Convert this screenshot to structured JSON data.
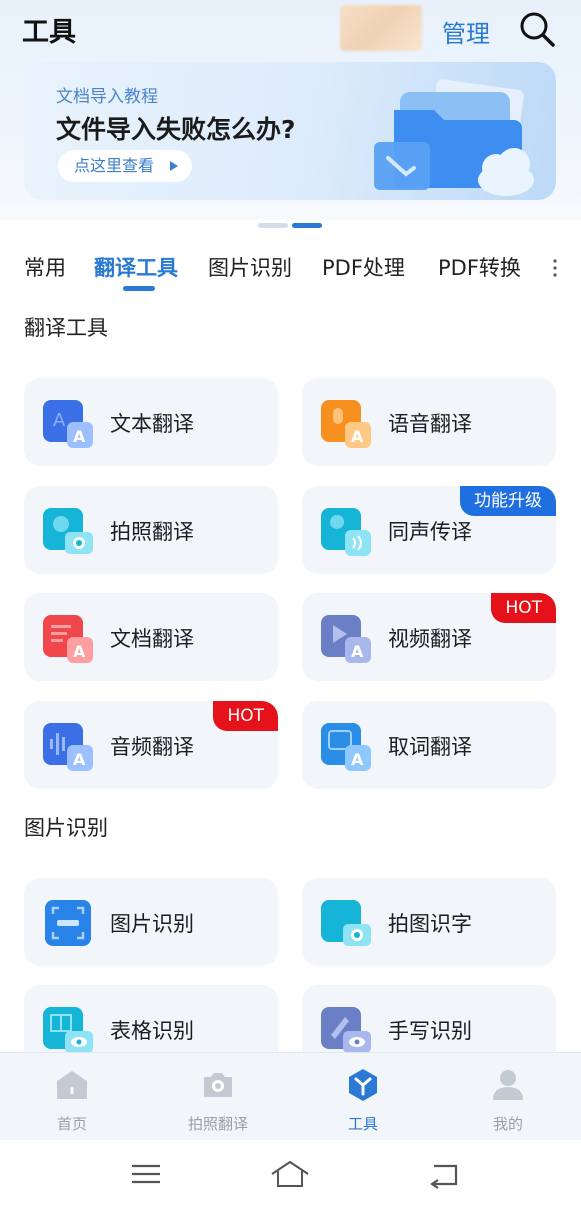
{
  "header": {
    "title": "工具",
    "manage_label": "管理"
  },
  "banner": {
    "subtitle": "文档导入教程",
    "title": "文件导入失败怎么办?",
    "button_label": "点这里查看"
  },
  "tabs": [
    {
      "label": "常用",
      "active": false
    },
    {
      "label": "翻译工具",
      "active": true
    },
    {
      "label": "图片识别",
      "active": false
    },
    {
      "label": "PDF处理",
      "active": false
    },
    {
      "label": "PDF转换",
      "active": false
    }
  ],
  "sections": {
    "translate": {
      "title": "翻译工具",
      "items": [
        {
          "label": "文本翻译",
          "icon": "text-translate-icon"
        },
        {
          "label": "语音翻译",
          "icon": "voice-translate-icon"
        },
        {
          "label": "拍照翻译",
          "icon": "photo-translate-icon"
        },
        {
          "label": "同声传译",
          "icon": "simultaneous-interpret-icon",
          "badge": "功能升级"
        },
        {
          "label": "文档翻译",
          "icon": "document-translate-icon"
        },
        {
          "label": "视频翻译",
          "icon": "video-translate-icon",
          "badge": "HOT"
        },
        {
          "label": "音频翻译",
          "icon": "audio-translate-icon",
          "badge": "HOT"
        },
        {
          "label": "取词翻译",
          "icon": "word-pick-translate-icon"
        }
      ]
    },
    "image": {
      "title": "图片识别",
      "items": [
        {
          "label": "图片识别",
          "icon": "image-recognition-icon"
        },
        {
          "label": "拍图识字",
          "icon": "photo-ocr-icon"
        },
        {
          "label": "表格识别",
          "icon": "table-recognition-icon"
        },
        {
          "label": "手写识别",
          "icon": "handwriting-recognition-icon"
        }
      ]
    }
  },
  "bottom_nav": [
    {
      "label": "首页",
      "icon": "home-icon",
      "active": false
    },
    {
      "label": "拍照翻译",
      "icon": "camera-icon",
      "active": false
    },
    {
      "label": "工具",
      "icon": "tools-icon",
      "active": true
    },
    {
      "label": "我的",
      "icon": "profile-icon",
      "active": false
    }
  ],
  "colors": {
    "accent": "#2a79d4",
    "hot_badge": "#e5121c",
    "upgrade_badge": "#1f6fe0",
    "card_bg": "#f2f5f9"
  }
}
